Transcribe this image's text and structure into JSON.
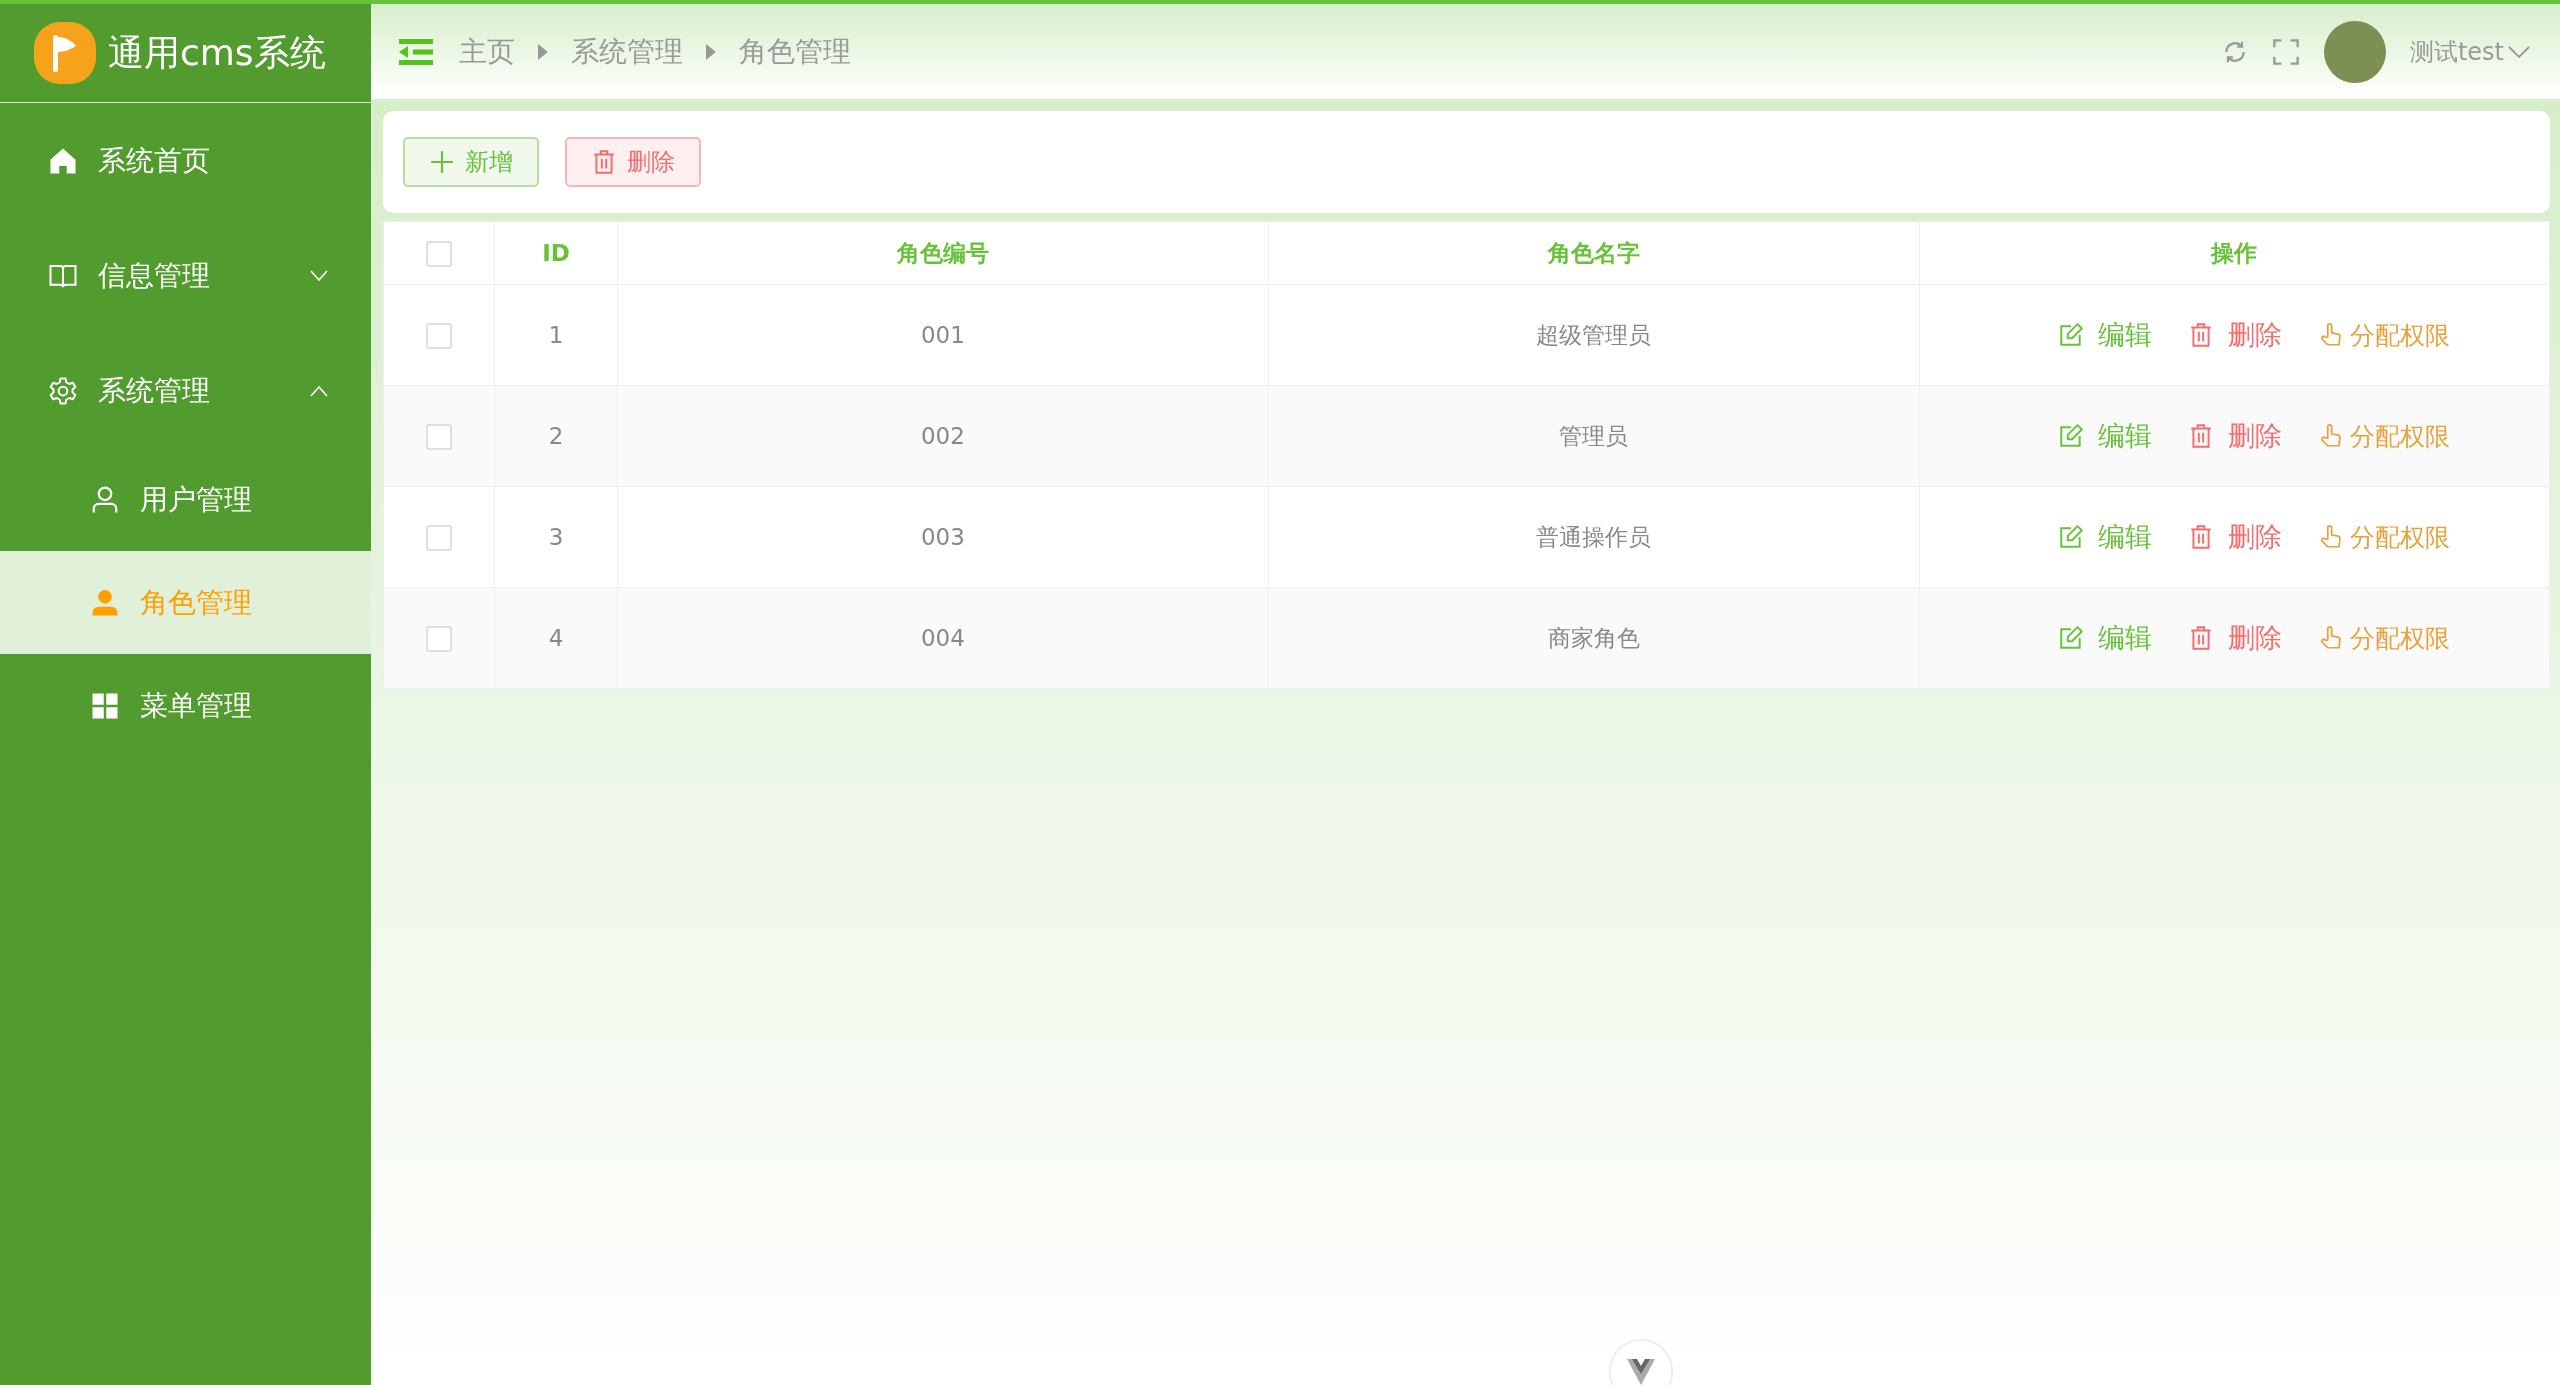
{
  "app": {
    "title": "通用cms系统"
  },
  "sidebar": {
    "items": [
      {
        "label": "系统首页",
        "kind": "home",
        "selected": false
      },
      {
        "label": "信息管理",
        "kind": "book",
        "selected": false,
        "expanded": false
      },
      {
        "label": "系统管理",
        "kind": "gear",
        "selected": false,
        "expanded": true,
        "children": [
          {
            "label": "用户管理",
            "kind": "user",
            "selected": false
          },
          {
            "label": "角色管理",
            "kind": "user",
            "selected": true
          },
          {
            "label": "菜单管理",
            "kind": "grid",
            "selected": false
          }
        ]
      }
    ]
  },
  "header": {
    "breadcrumb": [
      "主页",
      "系统管理",
      "角色管理"
    ],
    "user": "测试test"
  },
  "toolbar": {
    "buttons": [
      {
        "label": "新增",
        "kind": "add"
      },
      {
        "label": "删除",
        "kind": "delete"
      }
    ]
  },
  "table": {
    "checked": false,
    "columns": [
      "ID",
      "角色编号",
      "角色名字",
      "操作"
    ],
    "rows": [
      {
        "checked": false,
        "cells": [
          "1",
          "001",
          "超级管理员"
        ],
        "actions": [
          {
            "label": "编辑",
            "kind": "edit"
          },
          {
            "label": "删除",
            "kind": "delete"
          },
          {
            "label": "分配权限",
            "kind": "assign"
          }
        ]
      },
      {
        "checked": false,
        "cells": [
          "2",
          "002",
          "管理员"
        ],
        "actions": [
          {
            "label": "编辑",
            "kind": "edit"
          },
          {
            "label": "删除",
            "kind": "delete"
          },
          {
            "label": "分配权限",
            "kind": "assign"
          }
        ]
      },
      {
        "checked": false,
        "cells": [
          "3",
          "003",
          "普通操作员"
        ],
        "actions": [
          {
            "label": "编辑",
            "kind": "edit"
          },
          {
            "label": "删除",
            "kind": "delete"
          },
          {
            "label": "分配权限",
            "kind": "assign"
          }
        ]
      },
      {
        "checked": false,
        "cells": [
          "4",
          "004",
          "商家角色"
        ],
        "actions": [
          {
            "label": "编辑",
            "kind": "edit"
          },
          {
            "label": "删除",
            "kind": "delete"
          },
          {
            "label": "分配权限",
            "kind": "assign"
          }
        ]
      }
    ]
  }
}
